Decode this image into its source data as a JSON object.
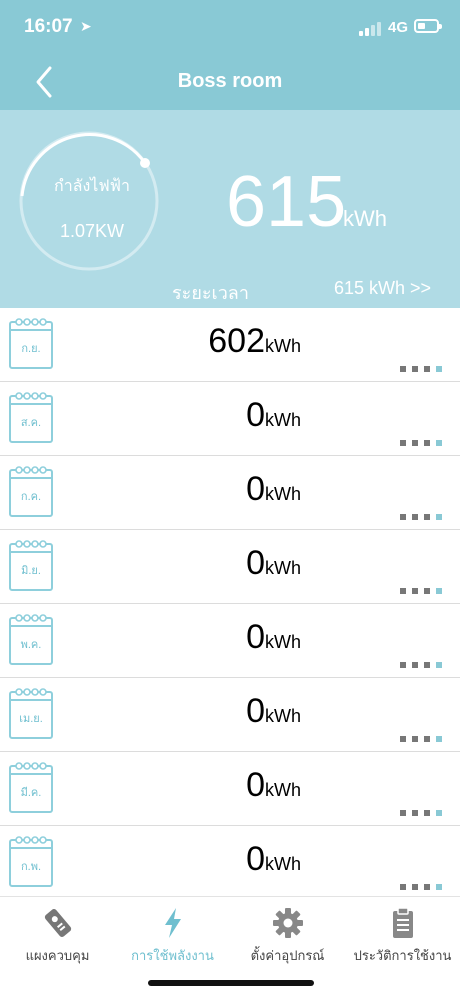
{
  "status": {
    "time": "16:07",
    "network": "4G"
  },
  "header": {
    "title": "Boss room"
  },
  "summary": {
    "power_label": "กำลังไฟฟ้า",
    "power_value": "1.07KW",
    "total_value": "615",
    "total_unit": "kWh",
    "period_label": "ระยะเวลา",
    "period_total": "615 kWh >>"
  },
  "months": [
    {
      "month": "ก.ย.",
      "value": "602",
      "unit": "kWh"
    },
    {
      "month": "ส.ค.",
      "value": "0",
      "unit": "kWh"
    },
    {
      "month": "ก.ค.",
      "value": "0",
      "unit": "kWh"
    },
    {
      "month": "มิ.ย.",
      "value": "0",
      "unit": "kWh"
    },
    {
      "month": "พ.ค.",
      "value": "0",
      "unit": "kWh"
    },
    {
      "month": "เม.ย.",
      "value": "0",
      "unit": "kWh"
    },
    {
      "month": "มี.ค.",
      "value": "0",
      "unit": "kWh"
    },
    {
      "month": "ก.พ.",
      "value": "0",
      "unit": "kWh"
    }
  ],
  "tabs": [
    {
      "label": "แผงควบคุม",
      "icon": "control-panel-icon",
      "active": false
    },
    {
      "label": "การใช้พลังงาน",
      "icon": "lightning-icon",
      "active": true
    },
    {
      "label": "ตั้งค่าอุปกรณ์",
      "icon": "gear-icon",
      "active": false
    },
    {
      "label": "ประวัติการใช้งาน",
      "icon": "clipboard-icon",
      "active": false
    }
  ],
  "colors": {
    "accent": "#89c9d5",
    "panel": "#b0dbe5",
    "icon": "#8ecfdc",
    "dots": "#777777"
  }
}
